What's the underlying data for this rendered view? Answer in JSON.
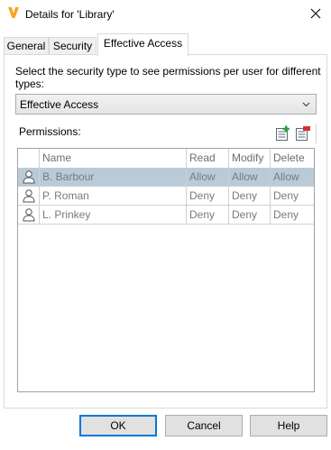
{
  "window": {
    "title": "Details for 'Library'",
    "app_icon": "vault-v-icon",
    "close_icon": "close-icon"
  },
  "tabs": [
    {
      "label": "General",
      "active": false
    },
    {
      "label": "Security",
      "active": false
    },
    {
      "label": "Effective Access",
      "active": true
    }
  ],
  "panel": {
    "prompt": "Select the security type to see permissions per user for different types:",
    "security_type": {
      "selected": "Effective Access"
    },
    "permissions_label": "Permissions:",
    "toolbar": {
      "add_icon": "add-permission-icon",
      "remove_icon": "remove-permission-icon"
    },
    "table": {
      "columns": [
        "Name",
        "Read",
        "Modify",
        "Delete"
      ],
      "rows": [
        {
          "name": "B. Barbour",
          "read": "Allow",
          "modify": "Allow",
          "delete": "Allow",
          "selected": true
        },
        {
          "name": "P. Roman",
          "read": "Deny",
          "modify": "Deny",
          "delete": "Deny",
          "selected": false
        },
        {
          "name": "L. Prinkey",
          "read": "Deny",
          "modify": "Deny",
          "delete": "Deny",
          "selected": false
        }
      ]
    }
  },
  "buttons": {
    "ok": "OK",
    "cancel": "Cancel",
    "help": "Help"
  },
  "colors": {
    "selection": "#b9cbd9",
    "default_button_border": "#0078d7",
    "icon_orange": "#f5a623"
  }
}
